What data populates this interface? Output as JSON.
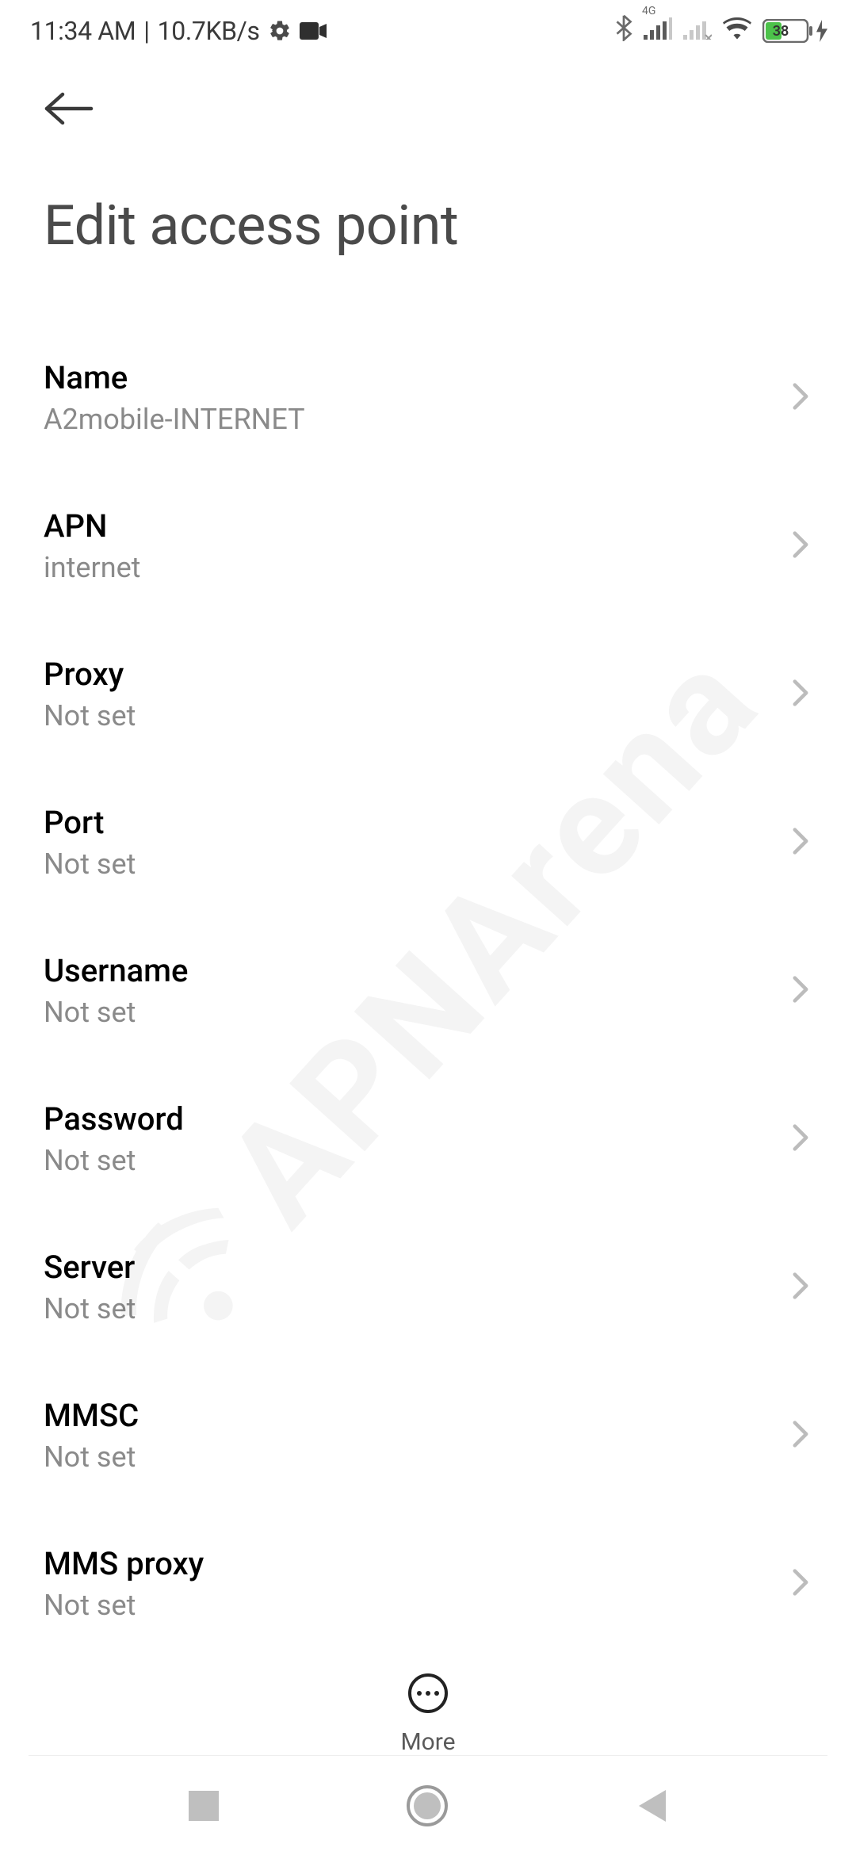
{
  "status_bar": {
    "time": "11:34 AM",
    "separator": "|",
    "data_rate": "10.7KB/s",
    "battery_percent": "38",
    "network_badge": "4G"
  },
  "header": {
    "title": "Edit access point"
  },
  "settings": [
    {
      "label": "Name",
      "value": "A2mobile-INTERNET"
    },
    {
      "label": "APN",
      "value": "internet"
    },
    {
      "label": "Proxy",
      "value": "Not set"
    },
    {
      "label": "Port",
      "value": "Not set"
    },
    {
      "label": "Username",
      "value": "Not set"
    },
    {
      "label": "Password",
      "value": "Not set"
    },
    {
      "label": "Server",
      "value": "Not set"
    },
    {
      "label": "MMSC",
      "value": "Not set"
    },
    {
      "label": "MMS proxy",
      "value": "Not set"
    }
  ],
  "bottom_action": {
    "more_label": "More"
  },
  "watermark": "APNArena"
}
